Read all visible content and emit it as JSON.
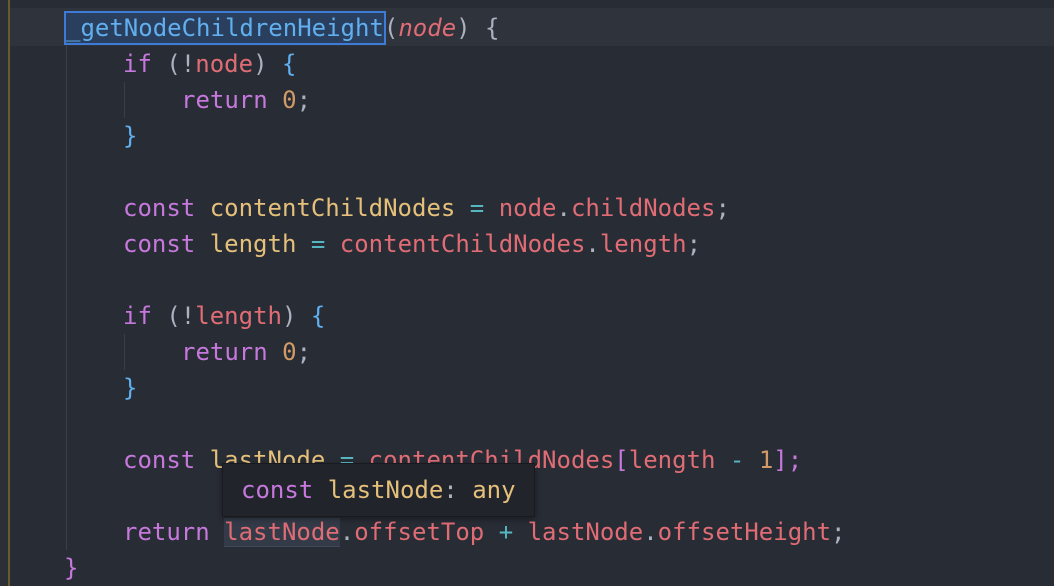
{
  "editor": {
    "function_name": "_getNodeChildrenHeight",
    "param": "node",
    "tokens": {
      "open_paren": "(",
      "close_paren_brace": ") {",
      "kw_if": "if",
      "kw_return": "return",
      "kw_const": "const",
      "open_if_paren_not": " (!",
      "close_if_paren": ") ",
      "lbrace": "{",
      "rbrace": "}",
      "zero": "0",
      "semicolon": ";",
      "eq": " = ",
      "dot": ".",
      "plus": " + ",
      "minus": " - ",
      "lbracket": "[",
      "rbracket_semi": "];",
      "one": "1",
      "space": " "
    },
    "identifiers": {
      "node": "node",
      "contentChildNodes": "contentChildNodes",
      "childNodes": "childNodes",
      "length": "length",
      "lastNode": "lastNode",
      "offsetTop": "offsetTop",
      "offsetHeight": "offsetHeight"
    }
  },
  "tooltip": {
    "keyword": "const",
    "identifier": "lastNode",
    "colon": ":",
    "type": "any"
  }
}
